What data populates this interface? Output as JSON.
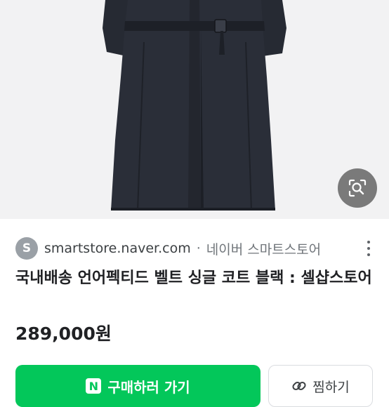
{
  "source": {
    "favicon_letter": "S",
    "domain": "smartstore.naver.com",
    "separator": "·",
    "site_name": "네이버 스마트스토어"
  },
  "product": {
    "title": "국내배송 언어펙티드 벨트 싱글 코트 블랙 : 셀샵스토어",
    "price": "289,000원"
  },
  "actions": {
    "buy_badge": "N",
    "buy_label": "구매하러 가기",
    "save_label": "찜하기"
  },
  "icons": {
    "lens": "visual-search-icon",
    "more": "more-vert-icon",
    "save": "link-icon"
  },
  "colors": {
    "accent": "#03c75a",
    "image_background": "#f2f2f3",
    "coat": "#262a33"
  }
}
